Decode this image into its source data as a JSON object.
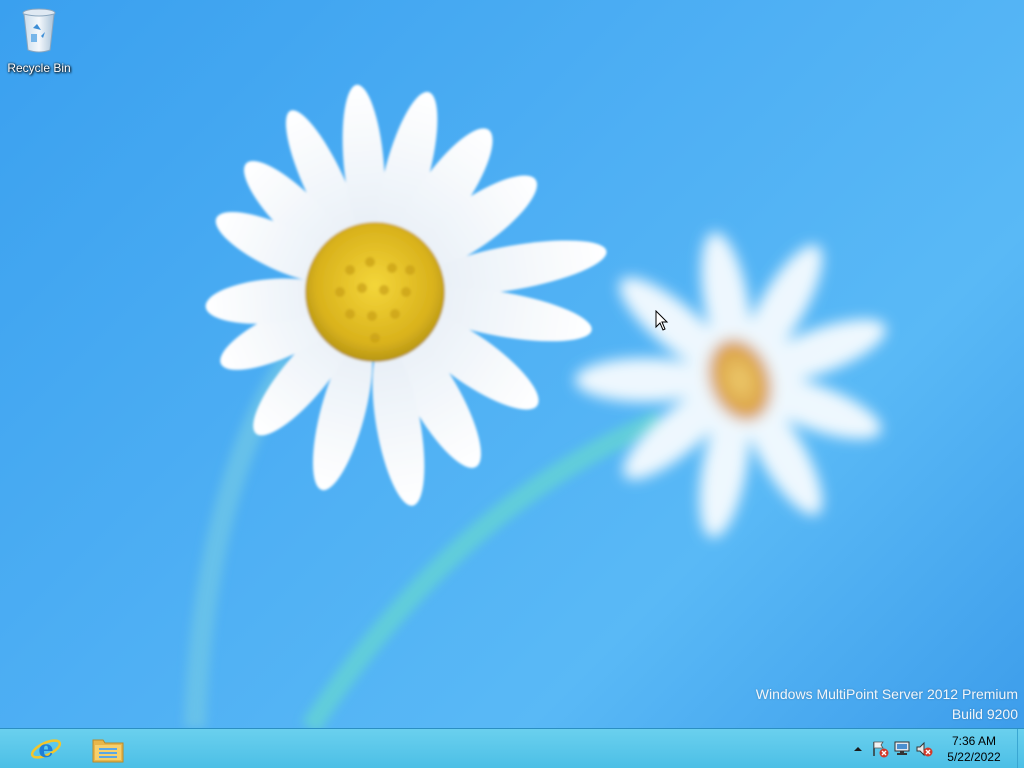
{
  "desktop": {
    "icons": [
      {
        "label": "Recycle Bin",
        "icon": "recycle-bin-icon"
      }
    ],
    "watermark": {
      "line1": "Windows MultiPoint Server 2012 Premium",
      "line2": "Build 9200"
    }
  },
  "taskbar": {
    "pinned": [
      {
        "icon": "internet-explorer-icon"
      },
      {
        "icon": "file-explorer-icon"
      }
    ],
    "tray": {
      "overflow_icon": "chevron-up-icon",
      "icons": [
        "action-center-flag-icon",
        "network-icon",
        "volume-muted-icon"
      ],
      "time": "7:36 AM",
      "date": "5/22/2022"
    }
  },
  "colors": {
    "sky": "#4fb0f4",
    "taskbar": "#5cc8ea",
    "petal": "#ffffff",
    "center": "#e0b820"
  }
}
